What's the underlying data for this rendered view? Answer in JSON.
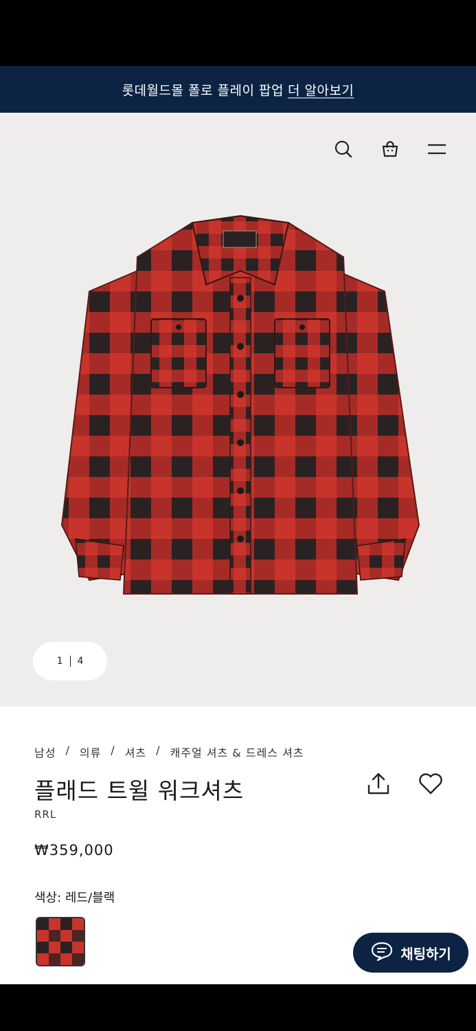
{
  "banner": {
    "text": "롯데월드몰 폴로 플레이 팝업",
    "link": "더 알아보기"
  },
  "header": {
    "icons": [
      "search-icon",
      "cart-icon",
      "menu-icon"
    ]
  },
  "gallery": {
    "current": "1",
    "total": "4"
  },
  "breadcrumb": [
    "남성",
    "의류",
    "셔츠",
    "캐주얼 셔츠 & 드레스 셔츠"
  ],
  "product": {
    "title": "플래드 트윌 워크셔츠",
    "brand": "RRL",
    "price": "₩359,000",
    "color_label": "색상: 레드/블랙",
    "swatch_colors": [
      "#c8342c",
      "#2a2222"
    ]
  },
  "actions": {
    "icons": [
      "share-icon",
      "heart-icon"
    ]
  },
  "chat": {
    "label": "채팅하기",
    "icon": "chat-icon"
  },
  "colors": {
    "navy": "#0c2344",
    "plaid_red": "#c8342c",
    "plaid_dark": "#2a2222"
  }
}
